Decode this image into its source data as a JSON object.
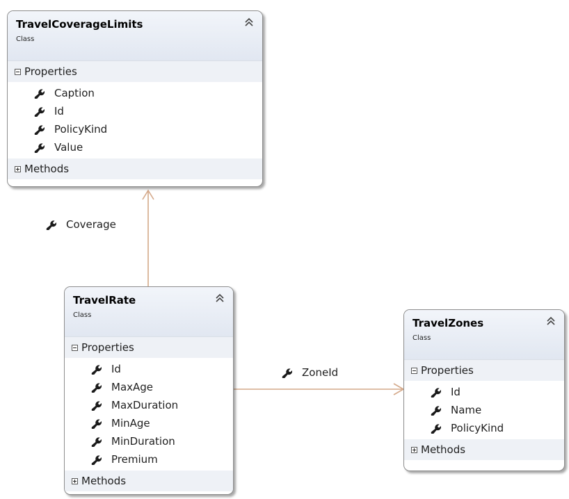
{
  "classes": {
    "coverage_limits": {
      "name": "TravelCoverageLimits",
      "stereotype": "Class",
      "properties_label": "Properties",
      "methods_label": "Methods",
      "properties": [
        "Caption",
        "Id",
        "PolicyKind",
        "Value"
      ]
    },
    "rate": {
      "name": "TravelRate",
      "stereotype": "Class",
      "properties_label": "Properties",
      "methods_label": "Methods",
      "properties": [
        "Id",
        "MaxAge",
        "MaxDuration",
        "MinAge",
        "MinDuration",
        "Premium"
      ]
    },
    "zones": {
      "name": "TravelZones",
      "stereotype": "Class",
      "properties_label": "Properties",
      "methods_label": "Methods",
      "properties": [
        "Id",
        "Name",
        "PolicyKind"
      ]
    }
  },
  "associations": {
    "coverage": "Coverage",
    "zone": "ZoneId"
  },
  "colors": {
    "connector": "#d4a889",
    "border": "#8d8d8d",
    "header": "#e6ebf3"
  },
  "icons": {
    "property": "wrench-icon",
    "collapse": "double-chevron-up-icon",
    "collapsed_section": "plus-box-icon",
    "expanded_section": "minus-box-icon"
  }
}
